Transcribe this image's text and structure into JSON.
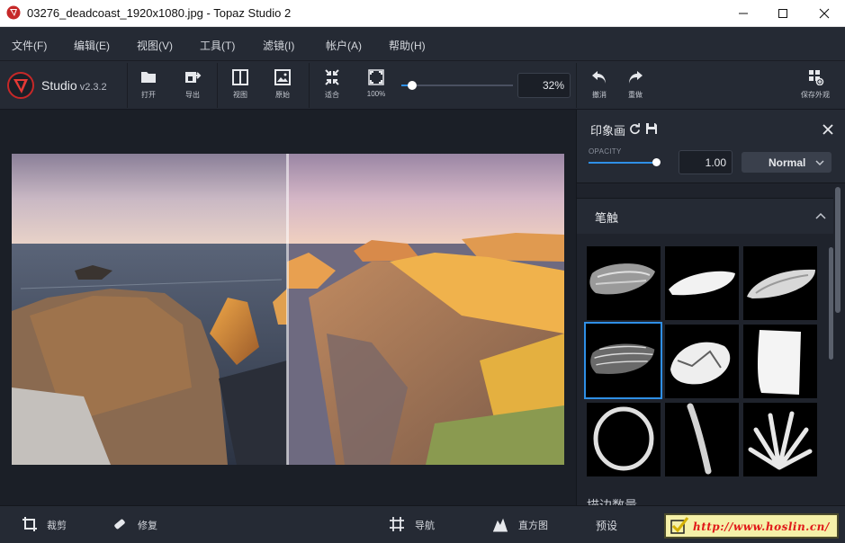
{
  "window": {
    "title": "03276_deadcoast_1920x1080.jpg - Topaz Studio 2"
  },
  "menu": [
    "文件(F)",
    "编辑(E)",
    "视图(V)",
    "工具(T)",
    "滤镜(I)",
    "帐户(A)",
    "帮助(H)"
  ],
  "brand": {
    "name": "Studio",
    "version": "v2.3.2"
  },
  "toolbar": {
    "open": "打开",
    "export": "导出",
    "view": "视图",
    "original": "原始",
    "fit": "适合",
    "full": "100%",
    "zoom": "32%",
    "zoom_level": 0.05,
    "undo": "撤消",
    "redo": "重做",
    "save_look": "保存外观"
  },
  "panel": {
    "title": "印象画",
    "opacity_label": "OPACITY",
    "opacity_value": "1.00",
    "blend_mode": "Normal",
    "section_title": "笔触",
    "sub_label": "描边数量"
  },
  "bottom": {
    "crop": "裁剪",
    "repair": "修复",
    "navigator": "导航",
    "histogram": "直方图",
    "presets": "预设"
  },
  "watermark": "http://www.hoslin.cn/",
  "colors": {
    "accent": "#2f8fe6",
    "panel": "#252a34",
    "background": "#1b1f27"
  }
}
